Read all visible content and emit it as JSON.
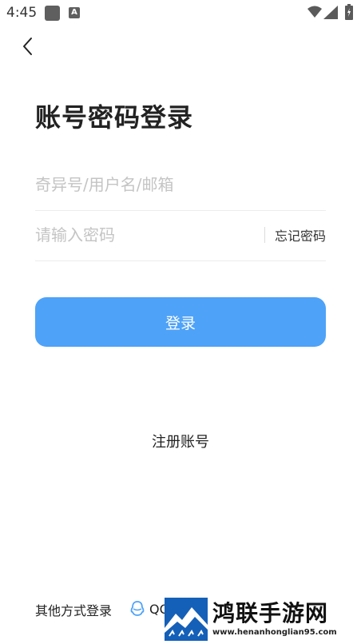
{
  "status_bar": {
    "time": "4:45",
    "notification_icons": [
      "app-square-icon",
      "a-letter-icon"
    ],
    "notification_a_letter": "A",
    "system_icons": [
      "wifi-icon",
      "signal-icon",
      "battery-charging-icon"
    ]
  },
  "header": {
    "back_icon": "chevron-left-icon",
    "title": "账号密码登录"
  },
  "form": {
    "account": {
      "placeholder": "奇异号/用户名/邮箱",
      "value": ""
    },
    "password": {
      "placeholder": "请输入密码",
      "value": ""
    },
    "forgot_password_label": "忘记密码"
  },
  "login_button": {
    "label": "登录",
    "color": "#4ea2f8"
  },
  "register_label": "注册账号",
  "other_login": {
    "label": "其他方式登录",
    "qq_label": "QQ",
    "qq_icon": "qq-penguin-icon"
  },
  "watermark": {
    "title": "鸿联手游网",
    "url": "www.henanhonglian95.com",
    "logo_color": "#1460b8"
  }
}
